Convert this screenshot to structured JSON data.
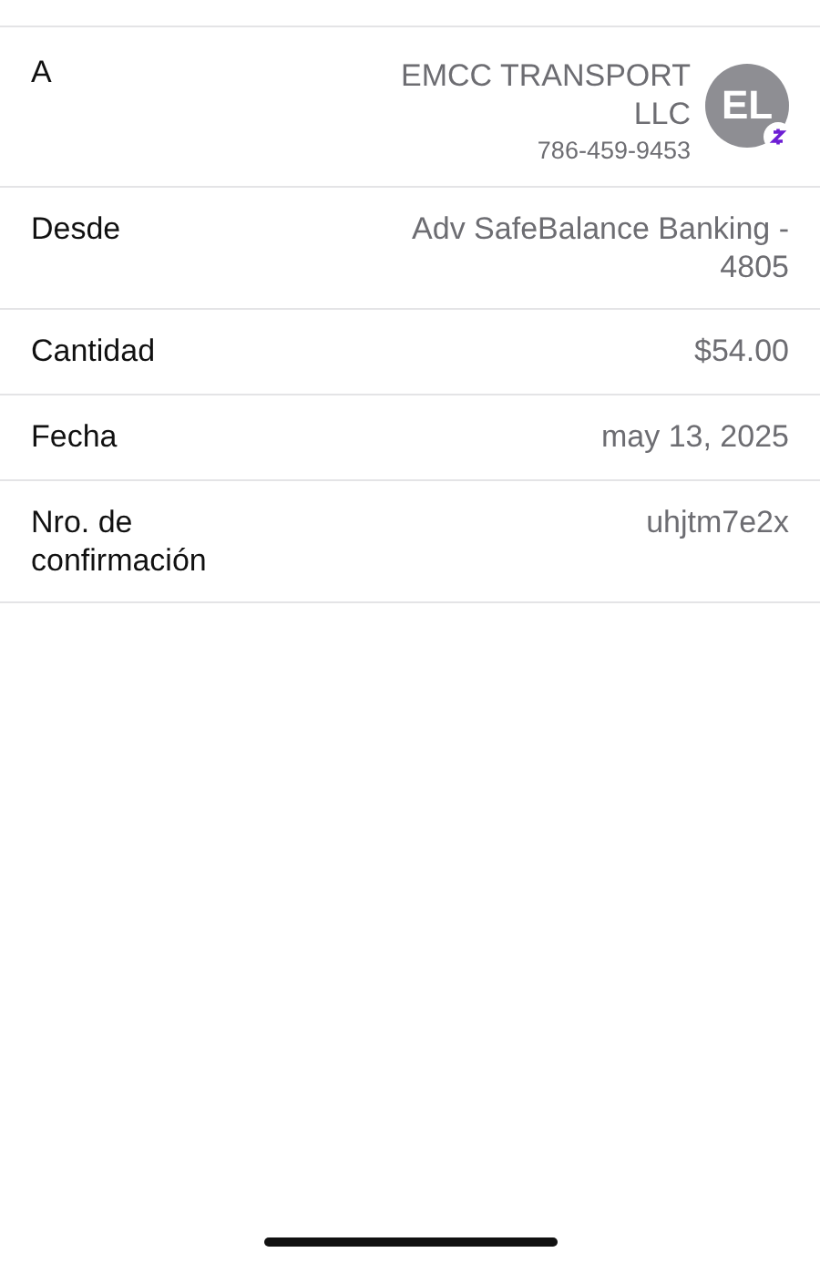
{
  "details": [
    {
      "kind": "recipient",
      "label": "A",
      "name": "EMCC TRANSPORT LLC",
      "phone": "786-459-9453",
      "initials": "EL"
    },
    {
      "kind": "plain",
      "label": "Desde",
      "value": "Adv SafeBalance Banking - 4805"
    },
    {
      "kind": "plain",
      "label": "Cantidad",
      "value": "$54.00"
    },
    {
      "kind": "plain",
      "label": "Fecha",
      "value": "may 13, 2025"
    },
    {
      "kind": "plain",
      "label": "Nro. de confirmación",
      "value": "uhjtm7e2x"
    }
  ]
}
